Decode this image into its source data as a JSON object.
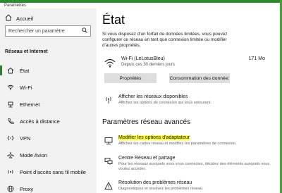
{
  "window": {
    "title": "Paramètres"
  },
  "sidebar": {
    "home_label": "Accueil",
    "search_placeholder": "Rechercher un paramètre",
    "section_title": "Réseau et Internet",
    "items": [
      {
        "label": "État",
        "icon": "home-network-icon",
        "active": true
      },
      {
        "label": "Wi-Fi",
        "icon": "wifi-icon"
      },
      {
        "label": "Ethernet",
        "icon": "ethernet-icon"
      },
      {
        "label": "Accès à distance",
        "icon": "phone-icon"
      },
      {
        "label": "VPN",
        "icon": "vpn-icon"
      },
      {
        "label": "Mode Avion",
        "icon": "airplane-icon"
      },
      {
        "label": "Point d'accès sans fil mobile",
        "icon": "hotspot-icon"
      },
      {
        "label": "Proxy",
        "icon": "globe-icon"
      }
    ]
  },
  "main": {
    "title": "État",
    "description": "Si vous disposez d'un forfait de données limitées, vous pouvez configurer ce réseau en tant que connexion limitée ou modifier d'autres propriétés.",
    "connection": {
      "name": "Wi-Fi (LeLotusBleu)",
      "subtitle": "Depuis ces 30 derniers jours",
      "usage": "171 Mo"
    },
    "buttons": {
      "properties": "Propriétés",
      "data_usage": "Consommation des donnée:"
    },
    "show_networks": {
      "title": "Afficher les réseaux disponibles",
      "subtitle": "Affichez les options de connexion qui vous entourent."
    },
    "advanced_title": "Paramètres réseau avancés",
    "adapter_options": {
      "title": "Modifier les options d'adaptateur",
      "subtitle": "Affichez les cartes réseau et modifiez les paramètres de connexion.",
      "highlight_color": "#ffff33"
    },
    "sharing_center": {
      "title": "Centre Réseau et partage",
      "subtitle": "Pour les réseaux auxquels vous vous connectez, décidez des éléments auxquels vous voulez accéder."
    },
    "troubleshoot": {
      "title": "Résolution des problèmes réseau",
      "subtitle": "Diagnostiquez et résolvez les problèmes réseau."
    }
  },
  "colors": {
    "accent": "#2e7d32",
    "sidebar_bg": "#f2f2f2",
    "button_bg": "#dedede"
  }
}
